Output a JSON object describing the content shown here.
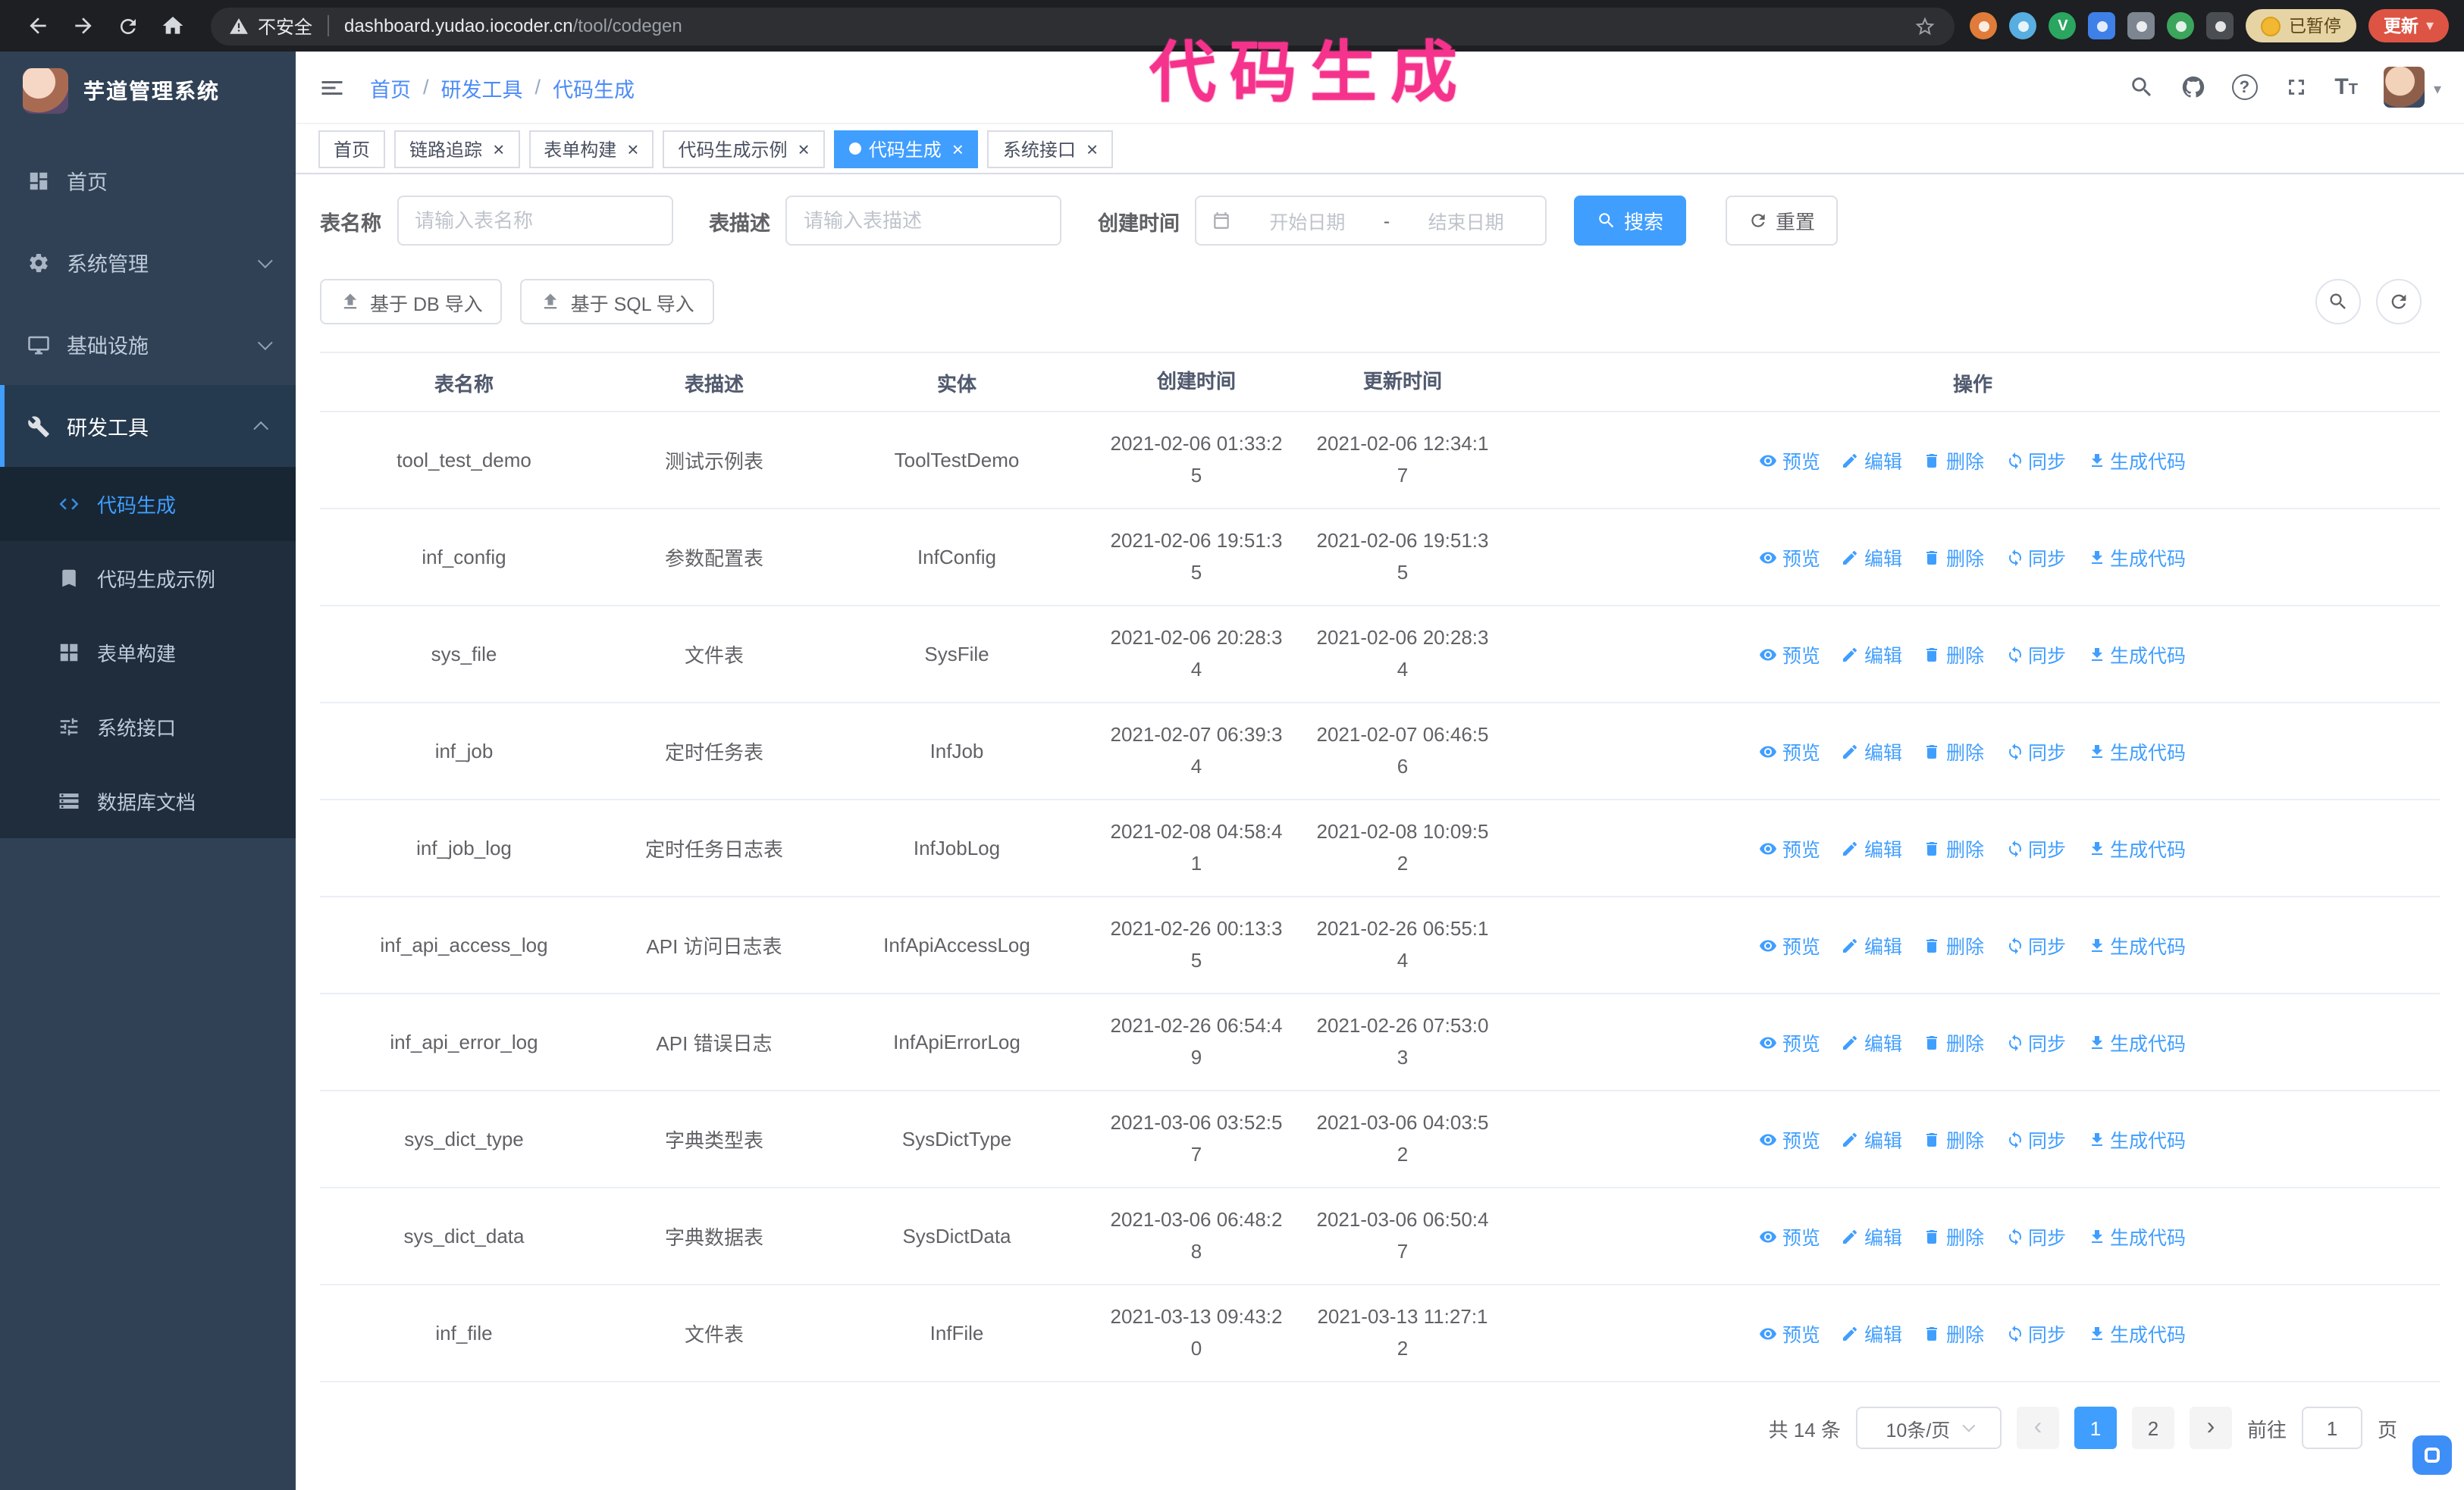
{
  "browser": {
    "security_warning": "不安全",
    "url_host": "dashboard.yudao.iocoder.cn",
    "url_path": "/tool/codegen",
    "paused_badge": "已暂停",
    "update_button": "更新"
  },
  "annotation": {
    "text": "代码生成",
    "color": "#f5338c"
  },
  "sidebar": {
    "logo_title": "芋道管理系统",
    "items": [
      {
        "label": "首页",
        "icon": "dashboard-icon"
      },
      {
        "label": "系统管理",
        "icon": "gear-icon"
      },
      {
        "label": "基础设施",
        "icon": "monitor-icon"
      },
      {
        "label": "研发工具",
        "icon": "tools-icon"
      }
    ],
    "sub_items": [
      {
        "label": "代码生成",
        "icon": "code-icon",
        "active": true
      },
      {
        "label": "代码生成示例",
        "icon": "bookmark-icon"
      },
      {
        "label": "表单构建",
        "icon": "grid-icon"
      },
      {
        "label": "系统接口",
        "icon": "tune-icon"
      },
      {
        "label": "数据库文档",
        "icon": "storage-icon"
      }
    ]
  },
  "header": {
    "breadcrumb": [
      "首页",
      "研发工具",
      "代码生成"
    ],
    "right_icons": [
      "search-icon",
      "github-icon",
      "help-icon",
      "fullscreen-icon",
      "font-size-icon",
      "avatar"
    ]
  },
  "tabs": [
    {
      "label": "首页",
      "closable": false,
      "active": false
    },
    {
      "label": "链路追踪",
      "closable": true,
      "active": false
    },
    {
      "label": "表单构建",
      "closable": true,
      "active": false
    },
    {
      "label": "代码生成示例",
      "closable": true,
      "active": false
    },
    {
      "label": "代码生成",
      "closable": true,
      "active": true
    },
    {
      "label": "系统接口",
      "closable": true,
      "active": false
    }
  ],
  "search_form": {
    "table_name_label": "表名称",
    "table_name_placeholder": "请输入表名称",
    "table_desc_label": "表描述",
    "table_desc_placeholder": "请输入表描述",
    "create_time_label": "创建时间",
    "start_date_placeholder": "开始日期",
    "range_separator": "-",
    "end_date_placeholder": "结束日期",
    "search_button": "搜索",
    "reset_button": "重置"
  },
  "toolbar": {
    "import_db_button": "基于 DB 导入",
    "import_sql_button": "基于 SQL 导入",
    "right_buttons": [
      "search-icon",
      "refresh-icon"
    ]
  },
  "table": {
    "columns": [
      "表名称",
      "表描述",
      "实体",
      "创建时间",
      "更新时间",
      "操作"
    ],
    "ops": [
      {
        "label": "预览",
        "icon": "eye-icon"
      },
      {
        "label": "编辑",
        "icon": "edit-icon"
      },
      {
        "label": "删除",
        "icon": "trash-icon"
      },
      {
        "label": "同步",
        "icon": "sync-icon"
      },
      {
        "label": "生成代码",
        "icon": "download-icon"
      }
    ],
    "rows": [
      {
        "name": "tool_test_demo",
        "desc": "测试示例表",
        "entity": "ToolTestDemo",
        "create_time": "2021-02-06 01:33:25",
        "update_time": "2021-02-06 12:34:17"
      },
      {
        "name": "inf_config",
        "desc": "参数配置表",
        "entity": "InfConfig",
        "create_time": "2021-02-06 19:51:35",
        "update_time": "2021-02-06 19:51:35"
      },
      {
        "name": "sys_file",
        "desc": "文件表",
        "entity": "SysFile",
        "create_time": "2021-02-06 20:28:34",
        "update_time": "2021-02-06 20:28:34"
      },
      {
        "name": "inf_job",
        "desc": "定时任务表",
        "entity": "InfJob",
        "create_time": "2021-02-07 06:39:34",
        "update_time": "2021-02-07 06:46:56"
      },
      {
        "name": "inf_job_log",
        "desc": "定时任务日志表",
        "entity": "InfJobLog",
        "create_time": "2021-02-08 04:58:41",
        "update_time": "2021-02-08 10:09:52"
      },
      {
        "name": "inf_api_access_log",
        "desc": "API 访问日志表",
        "entity": "InfApiAccessLog",
        "create_time": "2021-02-26 00:13:35",
        "update_time": "2021-02-26 06:55:14"
      },
      {
        "name": "inf_api_error_log",
        "desc": "API 错误日志",
        "entity": "InfApiErrorLog",
        "create_time": "2021-02-26 06:54:49",
        "update_time": "2021-02-26 07:53:03"
      },
      {
        "name": "sys_dict_type",
        "desc": "字典类型表",
        "entity": "SysDictType",
        "create_time": "2021-03-06 03:52:57",
        "update_time": "2021-03-06 04:03:52"
      },
      {
        "name": "sys_dict_data",
        "desc": "字典数据表",
        "entity": "SysDictData",
        "create_time": "2021-03-06 06:48:28",
        "update_time": "2021-03-06 06:50:47"
      },
      {
        "name": "inf_file",
        "desc": "文件表",
        "entity": "InfFile",
        "create_time": "2021-03-13 09:43:20",
        "update_time": "2021-03-13 11:27:12"
      }
    ]
  },
  "pagination": {
    "total_text": "共 14 条",
    "page_size": "10条/页",
    "pages": [
      "1",
      "2"
    ],
    "current_page": "1",
    "goto_label": "前往",
    "goto_value": "1",
    "goto_suffix": "页"
  },
  "colors": {
    "accent": "#409eff",
    "sidebar_bg": "#304156",
    "submenu_bg": "#1f2d3d",
    "annotation_pink": "#f5338c",
    "update_button_red": "#dd5444",
    "paused_badge_bg": "#e7d4a4",
    "browser_bar_bg": "#1d1f22",
    "link_blue": "#409eff"
  }
}
